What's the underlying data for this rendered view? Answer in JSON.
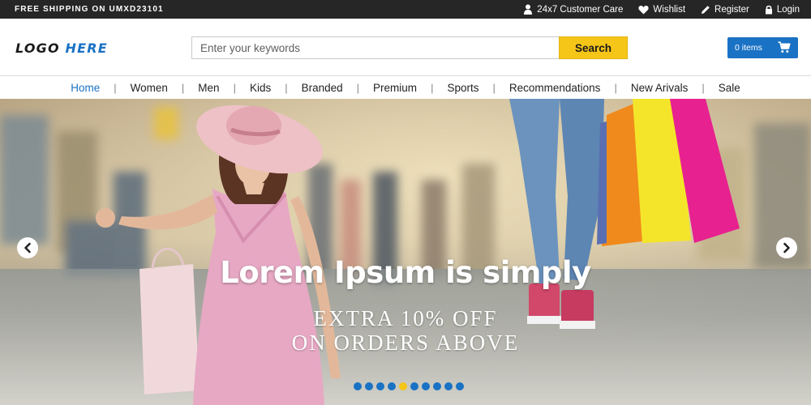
{
  "topbar": {
    "promo": "FREE SHIPPING ON UMXD23101",
    "links": [
      {
        "icon": "user-icon",
        "label": "24x7 Customer Care"
      },
      {
        "icon": "heart-icon",
        "label": "Wishlist"
      },
      {
        "icon": "pencil-icon",
        "label": "Register"
      },
      {
        "icon": "lock-icon",
        "label": "Login"
      }
    ]
  },
  "header": {
    "logo_part1": "LOGO",
    "logo_part2": "HERE",
    "search_placeholder": "Enter your keywords",
    "search_value": "",
    "search_button": "Search",
    "cart_label": "0 items"
  },
  "nav": {
    "items": [
      "Home",
      "Women",
      "Men",
      "Kids",
      "Branded",
      "Premium",
      "Sports",
      "Recommendations",
      "New Arivals",
      "Sale"
    ],
    "active": "Home",
    "separator": "|"
  },
  "hero": {
    "title": "Lorem Ipsum is simply",
    "subtitle_line1": "EXTRA 10% OFF",
    "subtitle_line2": "ON ORDERS ABOVE",
    "slide_count": 10,
    "active_slide": 4
  },
  "colors": {
    "accent_blue": "#1a72c4",
    "accent_yellow": "#f5c518",
    "topbar_bg": "#262626"
  }
}
